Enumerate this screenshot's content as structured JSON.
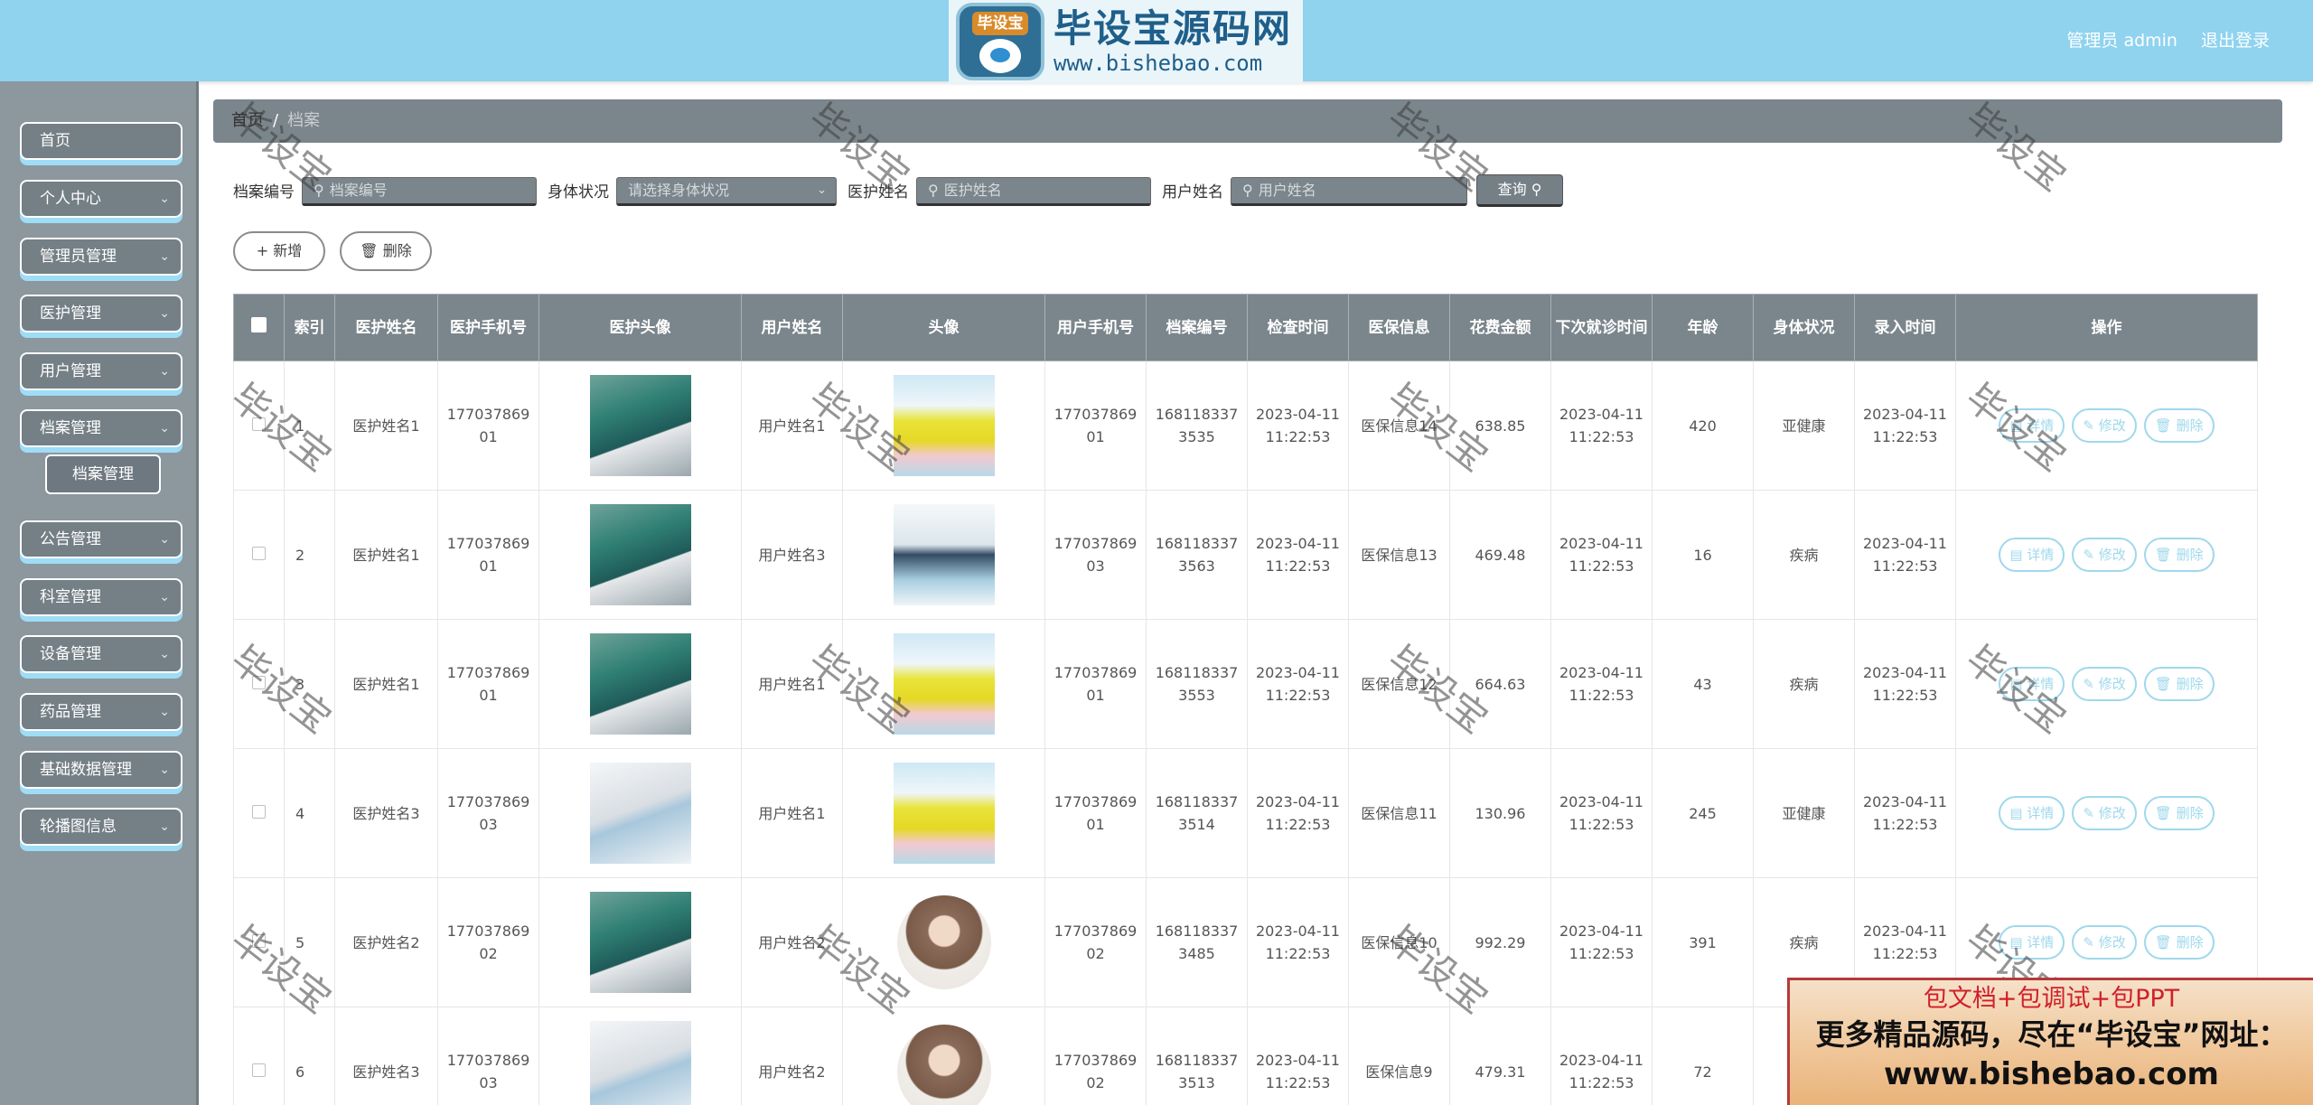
{
  "header": {
    "logo_badge": "毕设宝",
    "logo_title": "毕设宝源码网",
    "logo_url": "www.bishebao.com",
    "user_label": "管理员 admin",
    "logout_label": "退出登录"
  },
  "sidebar": {
    "items": [
      {
        "label": "首页",
        "has_chevron": false
      },
      {
        "label": "个人中心",
        "has_chevron": true
      },
      {
        "label": "管理员管理",
        "has_chevron": true
      },
      {
        "label": "医护管理",
        "has_chevron": true
      },
      {
        "label": "用户管理",
        "has_chevron": true
      },
      {
        "label": "档案管理",
        "has_chevron": true
      },
      {
        "label": "公告管理",
        "has_chevron": true
      },
      {
        "label": "科室管理",
        "has_chevron": true
      },
      {
        "label": "设备管理",
        "has_chevron": true
      },
      {
        "label": "药品管理",
        "has_chevron": true
      },
      {
        "label": "基础数据管理",
        "has_chevron": true
      },
      {
        "label": "轮播图信息",
        "has_chevron": true
      }
    ],
    "sub_item": "档案管理"
  },
  "breadcrumb": {
    "home": "首页",
    "separator": "/",
    "current": "档案"
  },
  "filters": {
    "archive_no_label": "档案编号",
    "archive_no_placeholder": "档案编号",
    "health_label": "身体状况",
    "health_placeholder": "请选择身体状况",
    "doctor_label": "医护姓名",
    "doctor_placeholder": "医护姓名",
    "user_label": "用户姓名",
    "user_placeholder": "用户姓名",
    "query_label": "查询"
  },
  "actions": {
    "add_label": "新增",
    "delete_label": "删除"
  },
  "table": {
    "headers": [
      "索引",
      "医护姓名",
      "医护手机号",
      "医护头像",
      "用户姓名",
      "头像",
      "用户手机号",
      "档案编号",
      "检查时间",
      "医保信息",
      "花费金额",
      "下次就诊时间",
      "年龄",
      "身体状况",
      "录入时间",
      "操作"
    ],
    "op_labels": {
      "detail": "详情",
      "edit": "修改",
      "delete": "删除"
    },
    "rows": [
      {
        "index": "1",
        "doctor_name": "医护姓名1",
        "doctor_phone": [
          "177037869",
          "01"
        ],
        "doctor_img": "surgery",
        "user_name": "用户姓名1",
        "user_img": "yellow",
        "user_phone": [
          "177037869",
          "01"
        ],
        "archive_no": [
          "168118337",
          "3535"
        ],
        "check_time": [
          "2023-04-11",
          "11:22:53"
        ],
        "insurance": "医保信息14",
        "cost": "638.85",
        "next_visit": [
          "2023-04-11",
          "11:22:53"
        ],
        "age": "420",
        "health": "亚健康",
        "entry_time": [
          "2023-04-11",
          "11:22:53"
        ]
      },
      {
        "index": "2",
        "doctor_name": "医护姓名1",
        "doctor_phone": [
          "177037869",
          "01"
        ],
        "doctor_img": "surgery",
        "user_name": "用户姓名3",
        "user_img": "blue",
        "user_phone": [
          "177037869",
          "03"
        ],
        "archive_no": [
          "168118337",
          "3563"
        ],
        "check_time": [
          "2023-04-11",
          "11:22:53"
        ],
        "insurance": "医保信息13",
        "cost": "469.48",
        "next_visit": [
          "2023-04-11",
          "11:22:53"
        ],
        "age": "16",
        "health": "疾病",
        "entry_time": [
          "2023-04-11",
          "11:22:53"
        ]
      },
      {
        "index": "3",
        "doctor_name": "医护姓名1",
        "doctor_phone": [
          "177037869",
          "01"
        ],
        "doctor_img": "surgery",
        "user_name": "用户姓名1",
        "user_img": "yellow",
        "user_phone": [
          "177037869",
          "01"
        ],
        "archive_no": [
          "168118337",
          "3553"
        ],
        "check_time": [
          "2023-04-11",
          "11:22:53"
        ],
        "insurance": "医保信息12",
        "cost": "664.63",
        "next_visit": [
          "2023-04-11",
          "11:22:53"
        ],
        "age": "43",
        "health": "疾病",
        "entry_time": [
          "2023-04-11",
          "11:22:53"
        ]
      },
      {
        "index": "4",
        "doctor_name": "医护姓名3",
        "doctor_phone": [
          "177037869",
          "03"
        ],
        "doctor_img": "nurses",
        "user_name": "用户姓名1",
        "user_img": "yellow",
        "user_phone": [
          "177037869",
          "01"
        ],
        "archive_no": [
          "168118337",
          "3514"
        ],
        "check_time": [
          "2023-04-11",
          "11:22:53"
        ],
        "insurance": "医保信息11",
        "cost": "130.96",
        "next_visit": [
          "2023-04-11",
          "11:22:53"
        ],
        "age": "245",
        "health": "亚健康",
        "entry_time": [
          "2023-04-11",
          "11:22:53"
        ]
      },
      {
        "index": "5",
        "doctor_name": "医护姓名2",
        "doctor_phone": [
          "177037869",
          "02"
        ],
        "doctor_img": "surgery",
        "user_name": "用户姓名2",
        "user_img": "round",
        "user_phone": [
          "177037869",
          "02"
        ],
        "archive_no": [
          "168118337",
          "3485"
        ],
        "check_time": [
          "2023-04-11",
          "11:22:53"
        ],
        "insurance": "医保信息10",
        "cost": "992.29",
        "next_visit": [
          "2023-04-11",
          "11:22:53"
        ],
        "age": "391",
        "health": "疾病",
        "entry_time": [
          "2023-04-11",
          "11:22:53"
        ]
      },
      {
        "index": "6",
        "doctor_name": "医护姓名3",
        "doctor_phone": [
          "177037869",
          "03"
        ],
        "doctor_img": "nurses",
        "user_name": "用户姓名2",
        "user_img": "round",
        "user_phone": [
          "177037869",
          "02"
        ],
        "archive_no": [
          "168118337",
          "3513"
        ],
        "check_time": [
          "2023-04-11",
          "11:22:53"
        ],
        "insurance": "医保信息9",
        "cost": "479.31",
        "next_visit": [
          "2023-04-11",
          "11:22:53"
        ],
        "age": "72",
        "health": "",
        "entry_time": [
          "",
          ""
        ]
      }
    ]
  },
  "watermark": "毕设宝",
  "promo": {
    "line1": "包文档+包调试+包PPT",
    "line2": "更多精品源码，尽在“毕设宝”网址：",
    "line3": "www.bishebao.com"
  }
}
